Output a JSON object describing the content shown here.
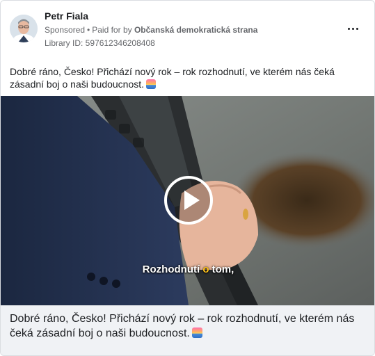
{
  "advertiser": {
    "name": "Petr Fiala",
    "sponsored_label": "Sponsored",
    "separator": "•",
    "paid_for_prefix": "Paid for by",
    "paid_for_entity": "Občanská demokratická strana",
    "library_id": "Library ID: 597612346208408"
  },
  "post": {
    "text": "Dobré ráno, Česko! Přichází nový rok – rok rozhodnutí, ve kterém nás čeká zásadní boj o naši budoucnost.",
    "emoji_icon": "sunrise-emoji"
  },
  "video": {
    "subtitle_before": "Rozhodnutí ",
    "subtitle_highlight": "o",
    "subtitle_after": " tom,",
    "subtitle_highlight_color": "#ffc21a",
    "play_icon": "play-icon"
  },
  "caption": {
    "text": "Dobré ráno, Česko! Přichází nový rok – rok rozhodnutí, ve kterém nás čeká zásadní boj o naši budoucnost.",
    "emoji_icon": "sunrise-emoji"
  },
  "menu_icon": "more-options-icon"
}
